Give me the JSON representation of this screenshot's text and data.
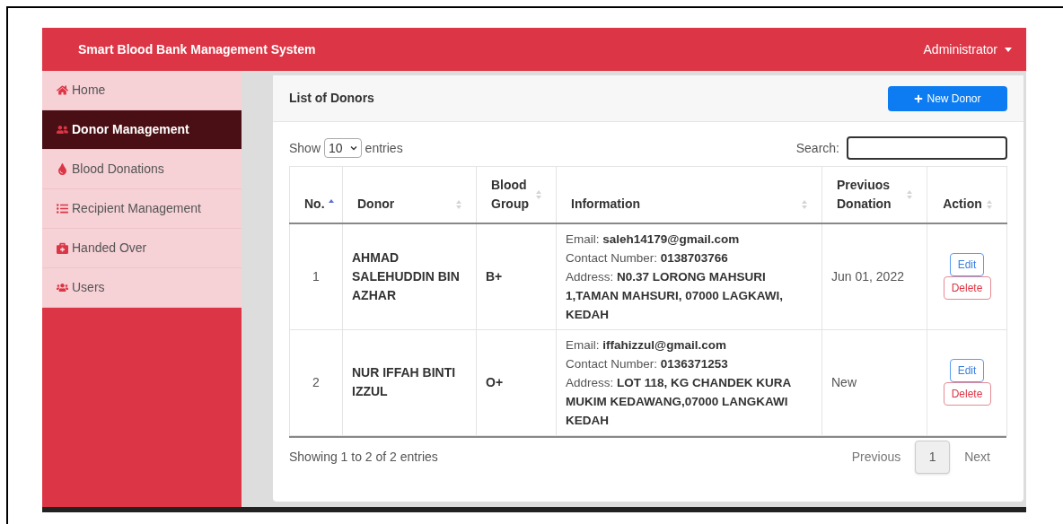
{
  "header": {
    "title": "Smart Blood Bank Management System",
    "user_menu": "Administrator"
  },
  "sidebar": {
    "items": [
      {
        "label": "Home",
        "selected": false
      },
      {
        "label": "Donor Management",
        "selected": true
      },
      {
        "label": "Blood Donations",
        "selected": false
      },
      {
        "label": "Recipient Management",
        "selected": false
      },
      {
        "label": "Handed Over",
        "selected": false
      },
      {
        "label": "Users",
        "selected": false
      }
    ]
  },
  "card": {
    "title": "List of Donors",
    "new_button": "New Donor"
  },
  "table_controls": {
    "show_label": "Show",
    "page_size": "10",
    "entries_label": "entries",
    "search_label": "Search:"
  },
  "table": {
    "columns": [
      {
        "label": "No.",
        "sorted": true
      },
      {
        "label": "Donor",
        "sorted": false
      },
      {
        "label": "Blood Group",
        "sorted": false
      },
      {
        "label": "Information",
        "sorted": false
      },
      {
        "label": "Previuos Donation",
        "sorted": false
      },
      {
        "label": "Action",
        "sorted": false
      }
    ],
    "rows": [
      {
        "no": "1",
        "donor": "AHMAD SALEHUDDIN BIN AZHAR",
        "blood_group": "B+",
        "info": [
          "Email: **saleh14179@gmail.com**",
          "Contact Number: **0138703766**",
          "Address: **N0.37 LORONG MAHSURI 1,TAMAN MAHSURI, 07000 LAGKAWI, KEDAH**"
        ],
        "previous_donation": "Jun 01, 2022",
        "actions": [
          "Edit",
          "Delete"
        ]
      },
      {
        "no": "2",
        "donor": "NUR IFFAH BINTI IZZUL",
        "blood_group": "O+",
        "info": [
          "Email: **iffahizzul@gmail.com**",
          "Contact Number: **0136371253**",
          "Address: **LOT 118, KG CHANDEK KURA MUKIM KEDAWANG,07000 LANGKAWI KEDAH**"
        ],
        "previous_donation": "New",
        "actions": [
          "Edit",
          "Delete"
        ]
      }
    ]
  },
  "footer": {
    "summary": "Showing 1 to 2 of 2 entries",
    "previous": "Previous",
    "pages": [
      {
        "label": "1",
        "selected": true
      }
    ],
    "next": "Next"
  }
}
